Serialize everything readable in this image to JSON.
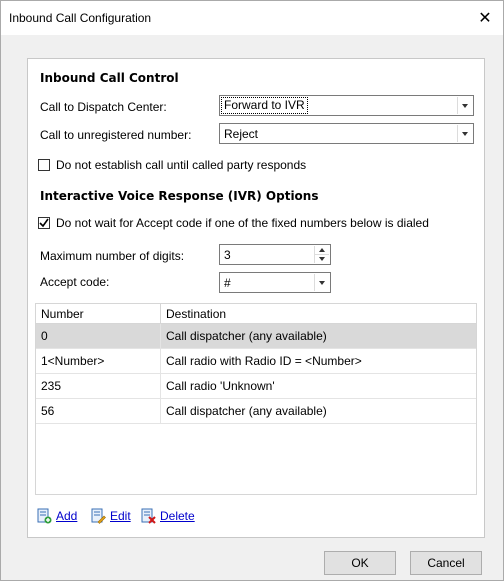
{
  "window": {
    "title": "Inbound Call Configuration",
    "close_glyph": "✕"
  },
  "inbound": {
    "heading": "Inbound Call Control",
    "dispatch_label": "Call to Dispatch Center:",
    "dispatch_value": "Forward to IVR",
    "unreg_label": "Call to unregistered number:",
    "unreg_value": "Reject",
    "establish_label": "Do not establish call until called party responds",
    "establish_checked": false
  },
  "ivr": {
    "heading": "Interactive Voice Response (IVR) Options",
    "nowait_label": "Do not wait for Accept code if one of the fixed numbers below is dialed",
    "nowait_checked": true,
    "maxdigits_label": "Maximum number of digits:",
    "maxdigits_value": "3",
    "accept_label": "Accept code:",
    "accept_value": "#"
  },
  "table": {
    "headers": [
      "Number",
      "Destination"
    ],
    "rows": [
      [
        "0",
        "Call dispatcher (any available)"
      ],
      [
        "1<Number>",
        "Call radio with Radio ID = <Number>"
      ],
      [
        "235",
        "Call radio 'Unknown'"
      ],
      [
        "56",
        "Call dispatcher (any available)"
      ]
    ],
    "selected_row": 0
  },
  "actions": {
    "add": "Add",
    "edit": "Edit",
    "delete": "Delete"
  },
  "buttons": {
    "ok": "OK",
    "cancel": "Cancel"
  },
  "colors": {
    "link": "#0000cc",
    "selected_row": "#d9d9d9"
  }
}
